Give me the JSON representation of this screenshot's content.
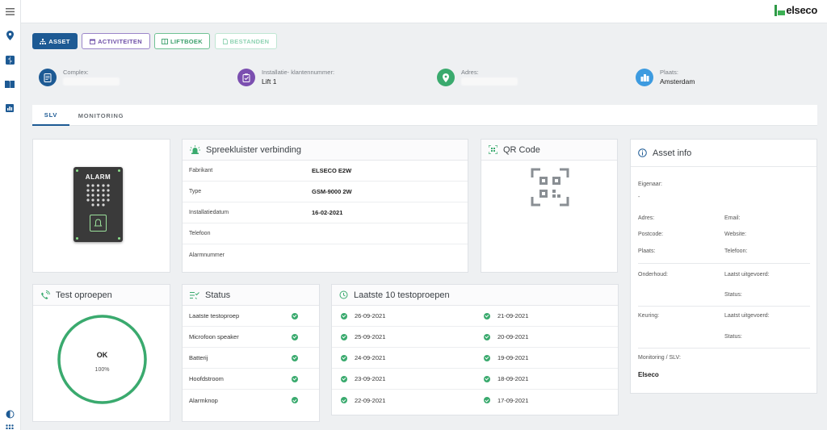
{
  "logo": {
    "text": "elseco"
  },
  "toolbar": {
    "asset": "ASSET",
    "activiteiten": "ACTIVITEITEN",
    "liftboek": "LIFTBOEK",
    "bestanden": "BESTANDEN"
  },
  "info": {
    "complex": {
      "label": "Complex:",
      "value": ""
    },
    "installatie": {
      "label": "Installatie- klantennummer:",
      "value": "Lift 1"
    },
    "adres": {
      "label": "Adres:",
      "value": ""
    },
    "plaats": {
      "label": "Plaats:",
      "value": "Amsterdam"
    }
  },
  "tabs": {
    "slv": "SLV",
    "monitoring": "MONITORING"
  },
  "device": {
    "label": "ALARM"
  },
  "spreekluister": {
    "title": "Spreekluister verbinding",
    "rows": [
      {
        "key": "Fabrikant",
        "value": "ELSECO E2W"
      },
      {
        "key": "Type",
        "value": "GSM-9000 2W"
      },
      {
        "key": "Installatiedatum",
        "value": "16-02-2021"
      },
      {
        "key": "Telefoon",
        "value": ""
      },
      {
        "key": "Alarmnummer",
        "value": ""
      }
    ]
  },
  "qr": {
    "title": "QR Code"
  },
  "asset_info": {
    "title": "Asset info",
    "eigenaar": "Eigenaar:",
    "eigenaar_value": "-",
    "adres": "Adres:",
    "email": "Email:",
    "postcode": "Postcode:",
    "website": "Website:",
    "plaats": "Plaats:",
    "telefoon": "Telefoon:",
    "onderhoud": "Onderhoud:",
    "onderhoud_laatst": "Laatst uitgevoerd:",
    "onderhoud_status": "Status:",
    "keuring": "Keuring:",
    "keuring_laatst": "Laatst uitgevoerd:",
    "keuring_status": "Status:",
    "monitoring_label": "Monitoring / SLV:",
    "monitoring_value": "Elseco"
  },
  "test_oproepen": {
    "title": "Test oproepen",
    "status": "OK",
    "percent": "100%",
    "fraction": 1.0
  },
  "status": {
    "title": "Status",
    "rows": [
      "Laatste testoproep",
      "Microfoon speaker",
      "Batterij",
      "Hoofdstroom",
      "Alarmknop"
    ]
  },
  "laatste": {
    "title": "Laatste 10 testoproepen",
    "col1": [
      "26-09-2021",
      "25-09-2021",
      "24-09-2021",
      "23-09-2021",
      "22-09-2021"
    ],
    "col2": [
      "21-09-2021",
      "20-09-2021",
      "19-09-2021",
      "18-09-2021",
      "17-09-2021"
    ]
  },
  "colors": {
    "primary": "#1d5a94",
    "green": "#3aaa6e",
    "purple": "#6e4fa8"
  }
}
